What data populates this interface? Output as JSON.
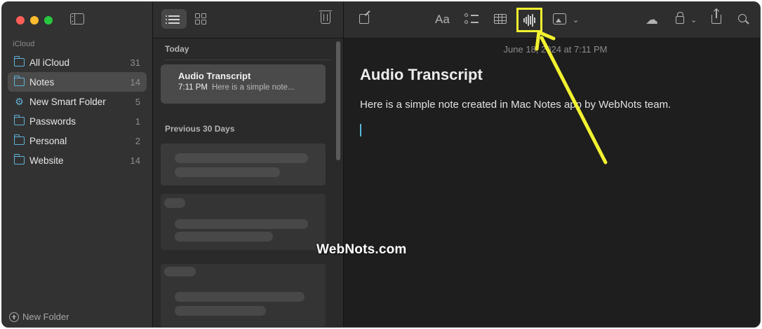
{
  "sidebar": {
    "section_title": "iCloud",
    "items": [
      {
        "label": "All iCloud",
        "count": "31",
        "icon": "folder-icon"
      },
      {
        "label": "Notes",
        "count": "14",
        "icon": "folder-icon",
        "selected": true
      },
      {
        "label": "New Smart Folder",
        "count": "5",
        "icon": "gear-icon"
      },
      {
        "label": "Passwords",
        "count": "1",
        "icon": "folder-icon"
      },
      {
        "label": "Personal",
        "count": "2",
        "icon": "folder-icon"
      },
      {
        "label": "Website",
        "count": "14",
        "icon": "folder-icon"
      }
    ],
    "new_folder_label": "New Folder"
  },
  "note_list": {
    "groups": [
      {
        "title": "Today"
      },
      {
        "title": "Previous 30 Days"
      }
    ],
    "selected_note": {
      "title": "Audio Transcript",
      "time": "7:11 PM",
      "snippet": "Here is a simple note..."
    }
  },
  "editor": {
    "toolbar": {
      "format_label": "Aa",
      "highlighted_button": "audio-recording-button",
      "highlight_color": "#f2f230"
    },
    "date": "June 18, 2024 at 7:11 PM",
    "title": "Audio Transcript",
    "body": "Here is a simple note created in Mac Notes app by WebNots team."
  },
  "watermark": "WebNots.com",
  "colors": {
    "accent": "#5fb1d6",
    "annotation": "#f2f230"
  }
}
